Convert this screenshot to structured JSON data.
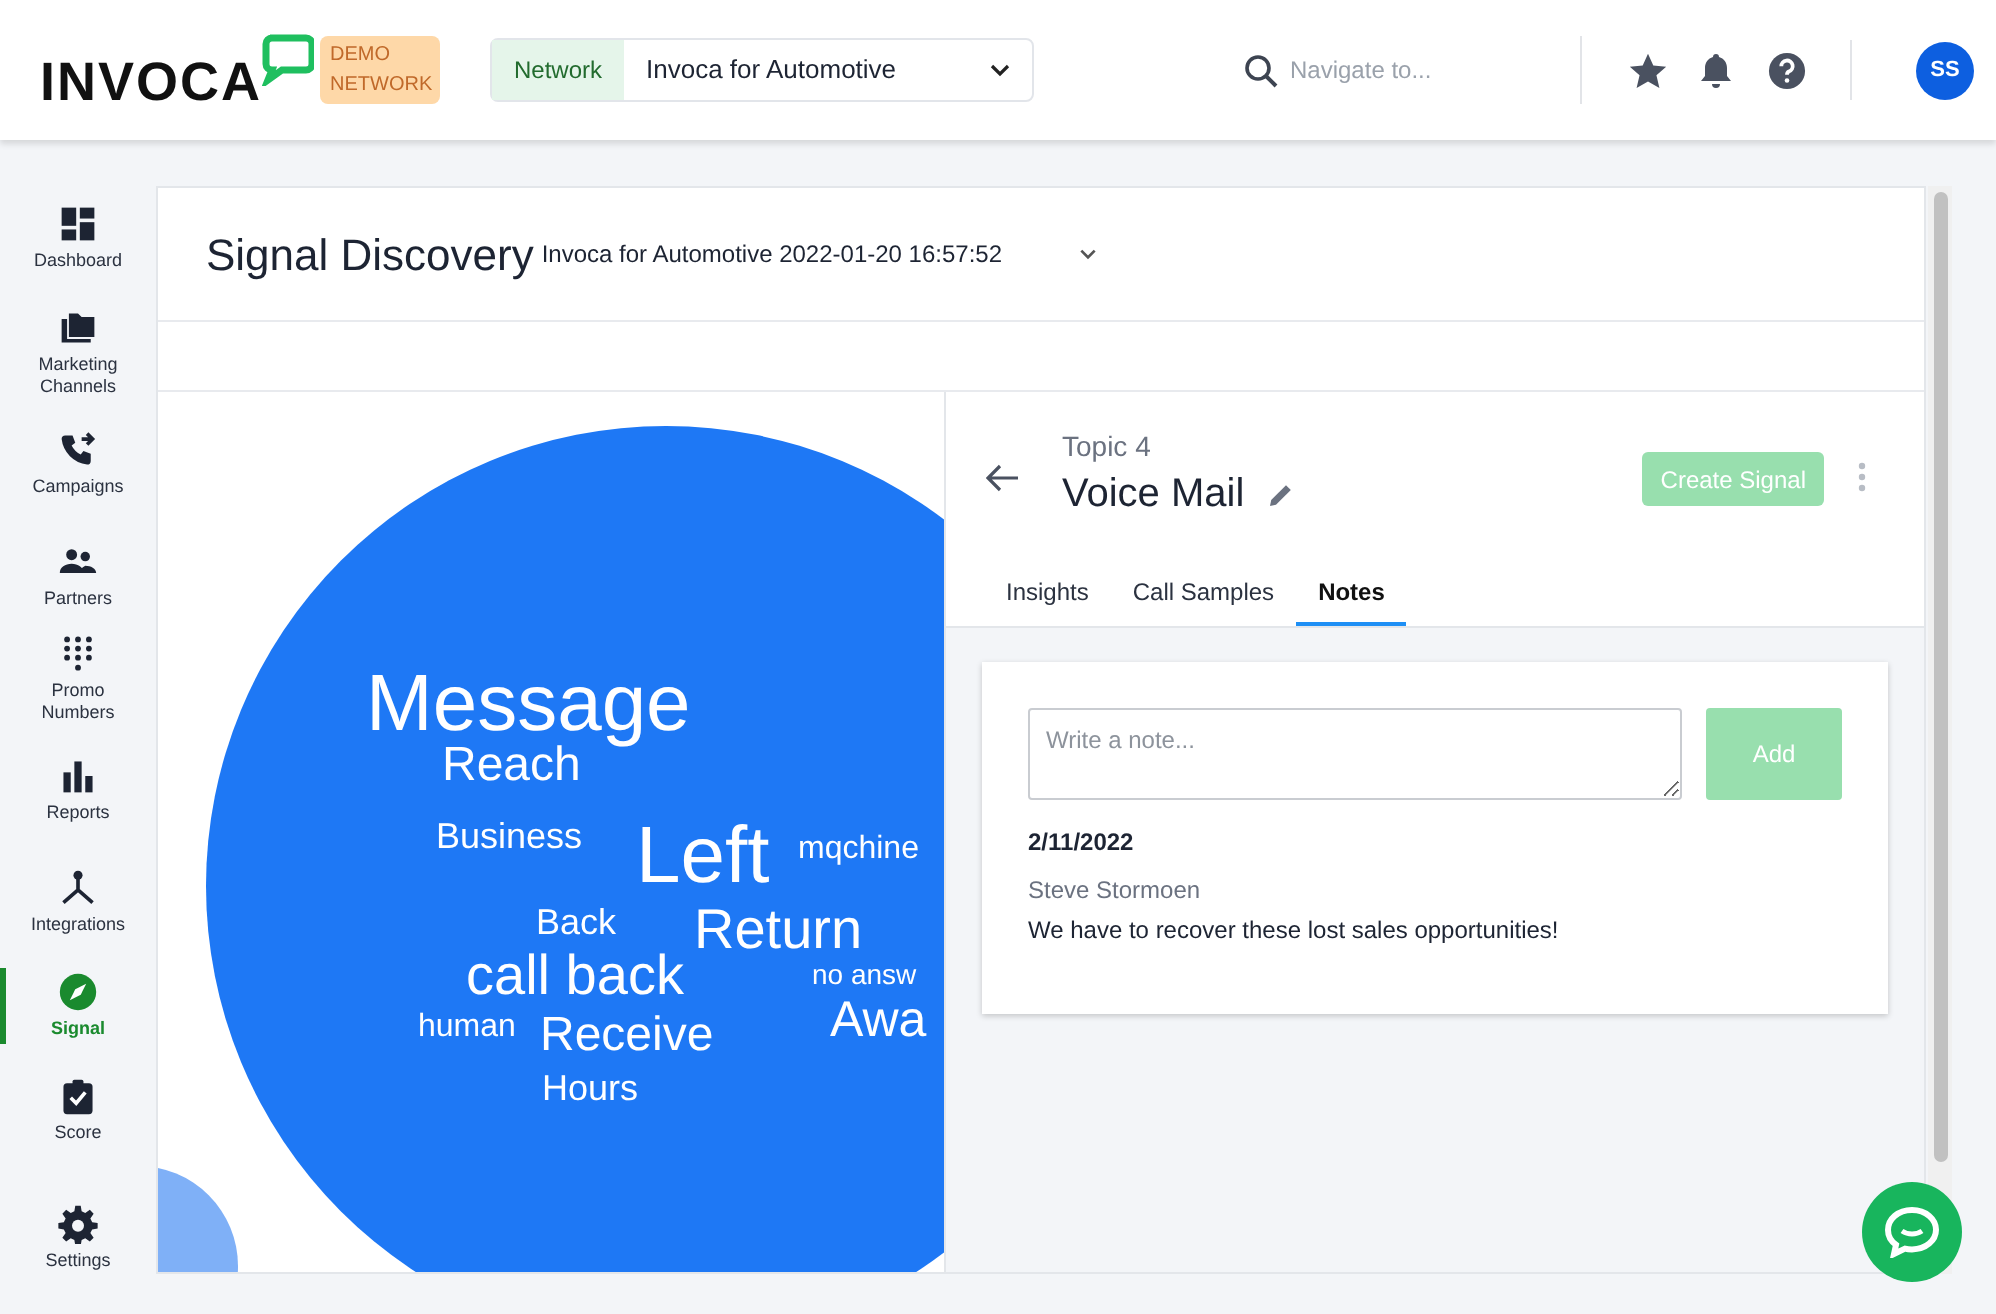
{
  "header": {
    "logo": "INVOCA",
    "badge": "DEMO NETWORK",
    "network_label": "Network",
    "network_value": "Invoca for Automotive",
    "search": {
      "placeholder": "Navigate to..."
    },
    "avatar": "SS"
  },
  "sidebar": {
    "items": [
      {
        "label": "Dashboard",
        "kind": "dashboard",
        "selected": false
      },
      {
        "label": "Marketing Channels",
        "kind": "folders",
        "selected": false
      },
      {
        "label": "Campaigns",
        "kind": "phone",
        "selected": false
      },
      {
        "label": "Partners",
        "kind": "people",
        "selected": false
      },
      {
        "label": "Promo Numbers",
        "kind": "dialpad",
        "selected": false
      },
      {
        "label": "Reports",
        "kind": "bars",
        "selected": false
      },
      {
        "label": "Integrations",
        "kind": "hub",
        "selected": false
      },
      {
        "label": "Signal",
        "kind": "compass",
        "selected": true
      },
      {
        "label": "Score",
        "kind": "clipboard",
        "selected": false
      },
      {
        "label": "Settings",
        "kind": "gear",
        "selected": false
      }
    ]
  },
  "page": {
    "title": "Signal Discovery",
    "context": "Invoca for Automotive 2022-01-20 16:57:52"
  },
  "word_cloud": {
    "words": [
      "Message",
      "Reach",
      "Business",
      "Left",
      "mqchine",
      "Back",
      "Return",
      "call back",
      "no answ",
      "human",
      "Receive",
      "Awa",
      "Hours"
    ]
  },
  "topic": {
    "eyebrow": "Topic 4",
    "name": "Voice Mail",
    "action": "Create Signal",
    "tabs": [
      {
        "label": "Insights",
        "selected": false
      },
      {
        "label": "Call Samples",
        "selected": false
      },
      {
        "label": "Notes",
        "selected": true
      }
    ],
    "note_input": {
      "placeholder": "Write a note..."
    },
    "add_button": "Add",
    "notes": [
      {
        "date": "2/11/2022",
        "author": "Steve Stormoen",
        "text": "We have to recover these lost sales opportunities!"
      }
    ]
  }
}
